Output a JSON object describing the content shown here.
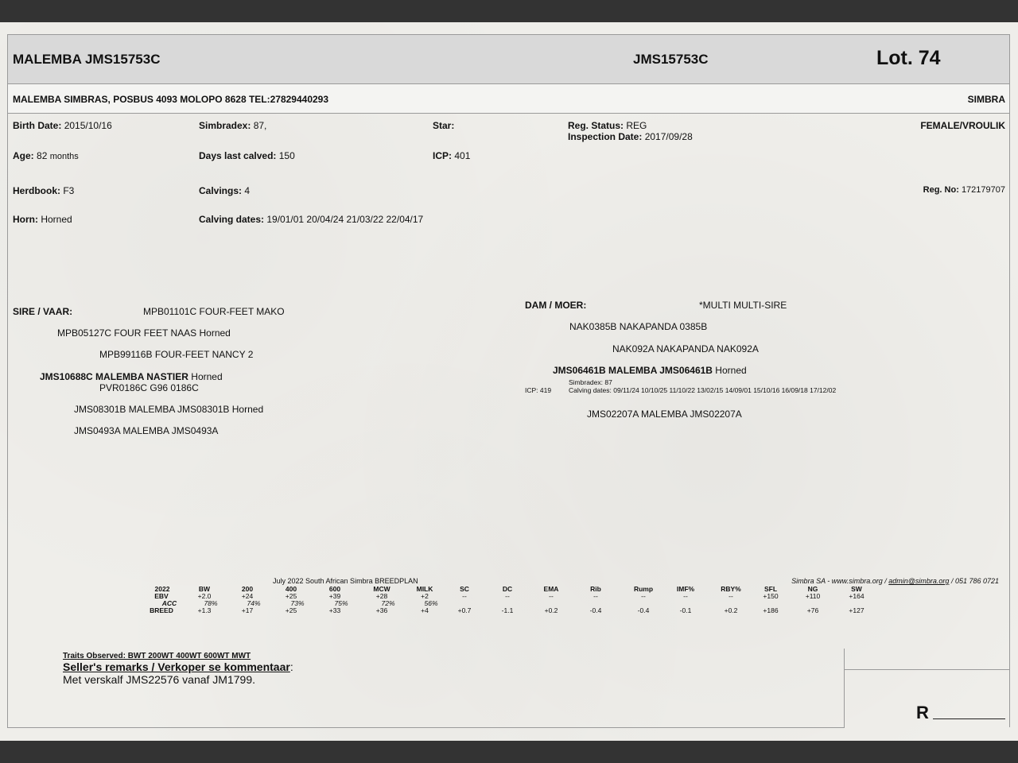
{
  "header": {
    "title": "MALEMBA JMS15753C",
    "code": "JMS15753C",
    "lot": "Lot. 74"
  },
  "address": {
    "breeder": "MALEMBA SIMBRAS, POSBUS 4093 MOLOPO 8628 TEL:27829440293",
    "breed": "SIMBRA"
  },
  "details": {
    "birth_date_label": "Birth Date:",
    "birth_date": "2015/10/16",
    "simbradex_label": "Simbradex:",
    "simbradex": "87,",
    "star_label": "Star:",
    "reg_status_label": "Reg. Status:",
    "reg_status": "REG",
    "inspection_label": "Inspection Date:",
    "inspection_date": "2017/09/28",
    "sex": "FEMALE/VROULIK",
    "age_label": "Age:",
    "age_value": "82",
    "age_unit": "months",
    "days_calved_label": "Days last calved:",
    "days_calved": "150",
    "icp_label": "ICP:",
    "icp": "401",
    "herdbook_label": "Herdbook:",
    "herdbook": "F3",
    "calvings_label": "Calvings:",
    "calvings": "4",
    "regno_label": "Reg. No:",
    "regno": "172179707",
    "horn_label": "Horn:",
    "horn": "Horned",
    "calving_dates_label": "Calving dates:",
    "calving_dates": "19/01/01  20/04/24  21/03/22  22/04/17"
  },
  "sire": {
    "label": "SIRE / VAAR:",
    "sire_sire": "MPB01101C FOUR-FEET MAKO",
    "sire_grandsire": "MPB05127C FOUR FEET NAAS  Horned",
    "sire_granddam": "MPB99116B FOUR-FEET NANCY 2",
    "sire_name": "JMS10688C MALEMBA NASTIER",
    "sire_horn": " Horned",
    "sire_dam_sire": "PVR0186C G96 0186C",
    "sire_dam": "JMS08301B MALEMBA JMS08301B  Horned",
    "sire_dam_dam": "JMS0493A MALEMBA JMS0493A"
  },
  "dam": {
    "label": "DAM / MOER:",
    "dam_sire_top": "*MULTI MULTI-SIRE",
    "dam_grandsire": "NAK0385B NAKAPANDA 0385B",
    "dam_granddam": "NAK092A NAKAPANDA NAK092A",
    "dam_name": "JMS06461B MALEMBA JMS06461B",
    "dam_horn": "  Horned",
    "dam_simbradex": "Simbradex: 87",
    "dam_icp": "ICP: 419",
    "dam_calving_dates": "Calving dates: 09/11/24  10/10/25  11/10/22  13/02/15  14/09/01  15/10/16  16/09/18  17/12/02",
    "dam_dam": "JMS02207A MALEMBA JMS02207A"
  },
  "breedplan": {
    "title": "July 2022 South African Simbra BREEDPLAN",
    "source_prefix": "Simbra SA - www.simbra.org / ",
    "source_email": "admin@simbra.org",
    "source_suffix": " / 051 786 0721",
    "headers": [
      "2022",
      "BW",
      "200",
      "400",
      "600",
      "MCW",
      "MILK",
      "SC",
      "DC",
      "EMA",
      "Rib",
      "Rump",
      "IMF%",
      "RBY%",
      "SFL",
      "NG",
      "SW"
    ],
    "ebv": [
      "EBV",
      "+2.0",
      "+24",
      "+25",
      "+39",
      "+28",
      "+2",
      "--",
      "--",
      "--",
      "--",
      "--",
      "--",
      "--",
      "+150",
      "+110",
      "+164"
    ],
    "acc": [
      "ACC",
      "78%",
      "74%",
      "73%",
      "75%",
      "72%",
      "56%",
      "",
      "",
      "",
      "",
      "",
      "",
      "",
      "",
      "",
      ""
    ],
    "breed": [
      "BREED",
      "+1.3",
      "+17",
      "+25",
      "+33",
      "+36",
      "+4",
      "+0.7",
      "-1.1",
      "+0.2",
      "-0.4",
      "-0.4",
      "-0.1",
      "+0.2",
      "+186",
      "+76",
      "+127"
    ]
  },
  "footer": {
    "traits": "Traits Observed: BWT  200WT  400WT  600WT  MWT",
    "remarks_label": "Seller's remarks / Verkoper se kommentaar",
    "remarks_colon": ":",
    "remarks_text": "Met verskalf JMS22576 vanaf JM1799.",
    "r_label": "R"
  }
}
